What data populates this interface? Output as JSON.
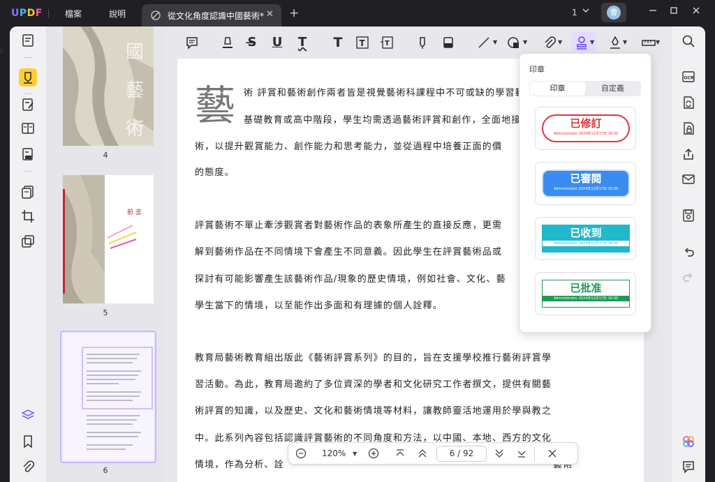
{
  "app": {
    "logo": "UPDF",
    "menu": [
      "檔案",
      "說明"
    ],
    "tab_title": "從文化角度認識中國藝術*",
    "window_count": "1",
    "avatar_initial": "會"
  },
  "thumbnails": {
    "pages": [
      "4",
      "5",
      "6"
    ],
    "page5_heading": "前 言"
  },
  "document": {
    "drop_cap": "藝",
    "lines": [
      "術 評賞和藝術創作兩者皆是視覺藝術科課程中不可或缺的學習範",
      "基礎教育或高中階段，學生均需透過藝術評賞和創作，全面地接",
      "術，以提升觀賞能力、創作能力和思考能力，並從過程中培養正面的價",
      "的態度。",
      "評賞藝術不單止牽涉觀賞者對藝術作品的表象所產生的直接反應，更需",
      "解到藝術作品在不同情境下會產生不同意義。因此學生在評賞藝術品或",
      "探討有可能影響產生該藝術作品/現象的歷史情境，例如社會、文化、藝",
      "學生當下的情境，以至能作出多面和有理據的個人詮釋。",
      "教育局藝術教育組出版此《藝術評賞系列》的目的，旨在支援學校推行藝術評賞學",
      "習活動。為此，教育局邀約了多位資深的學者和文化研究工作者撰文，提供有關藝",
      "術評賞的知識，以及歷史、文化和藝術情境等材料，讓教師靈活地運用於學與教之",
      "中。此系列內容包括認識評賞藝術的不同角度和方法，以中國、本地、西方的文化",
      "情境，作為分析、詮"
    ],
    "line_tail": "藝術"
  },
  "navbar": {
    "zoom": "120%",
    "current_page": "6",
    "separator": "/",
    "total_pages": "92"
  },
  "stamp_panel": {
    "title": "印章",
    "tabs": [
      "印章",
      "自定義"
    ],
    "stamps": [
      {
        "text": "已修訂",
        "sub": "Administrator 2024年12月17日 16:00",
        "color": "#e0343c"
      },
      {
        "text": "已審閱",
        "sub": "Administrator 2024年12月17日 16:00",
        "color": "#3a8cf0"
      },
      {
        "text": "已收到",
        "sub": "Administrator 2024年12月17日 16:00",
        "color": "#22b8cc"
      },
      {
        "text": "已批准",
        "sub": "Administrator 2024年12月17日 16:00",
        "color": "#1f9a55"
      }
    ]
  },
  "colors": {
    "accent_purple": "#9b6cff",
    "highlight_yellow": "#ffcf33",
    "titlebar_bg": "#1f1f24"
  }
}
